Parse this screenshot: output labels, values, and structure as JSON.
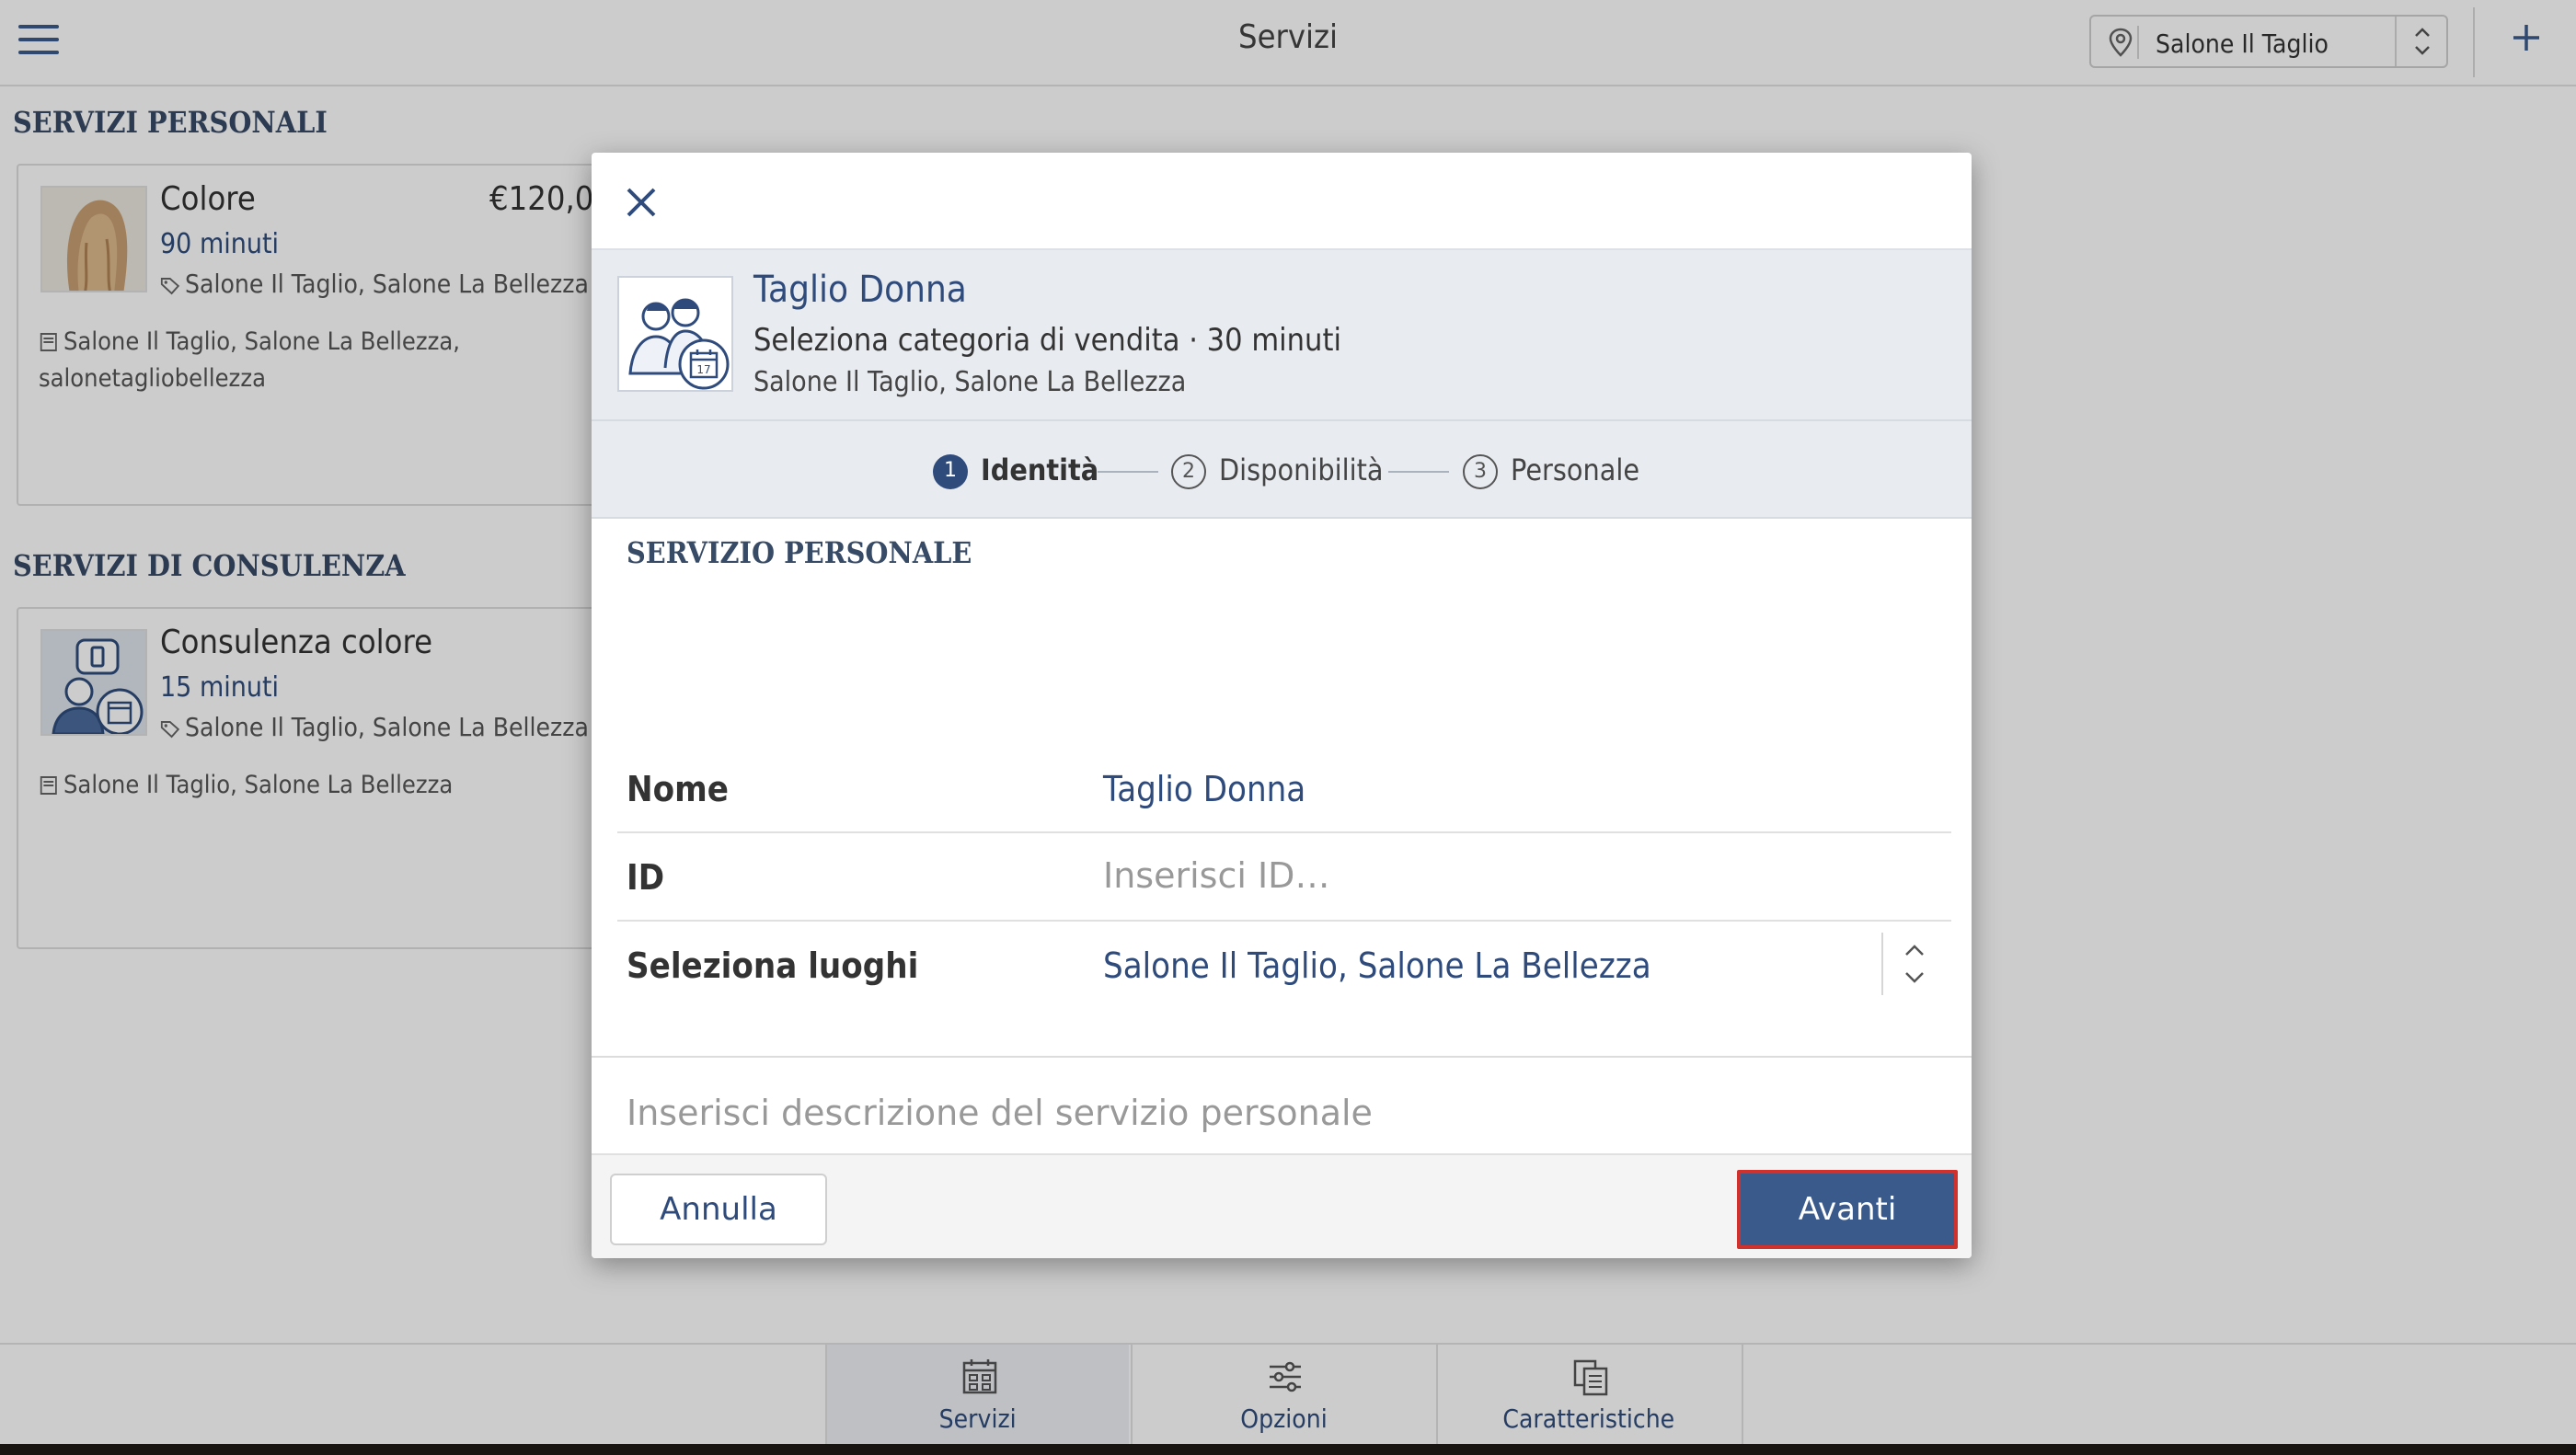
{
  "topbar": {
    "title": "Servizi",
    "location_value": "Salone Il Taglio"
  },
  "sections": [
    {
      "title": "SERVIZI PERSONALI",
      "card": {
        "name": "Colore",
        "price": "€120,0(",
        "duration": "90 minuti",
        "locations": "Salone Il Taglio, Salone La Bellezza",
        "sales_line1": "Salone Il Taglio, Salone La Bellezza,",
        "sales_line2": "salonetagliobellezza"
      }
    },
    {
      "title": "SERVIZI DI CONSULENZA",
      "card": {
        "name": "Consulenza colore",
        "duration": "15 minuti",
        "locations": "Salone Il Taglio, Salone La Bellezza",
        "sales_line1": "Salone Il Taglio, Salone La Bellezza"
      }
    }
  ],
  "bottom_tabs": [
    {
      "label": "Servizi",
      "icon": "grid-calendar-icon",
      "active": true
    },
    {
      "label": "Opzioni",
      "icon": "sliders-icon",
      "active": false
    },
    {
      "label": "Caratteristiche",
      "icon": "copy-list-icon",
      "active": false
    }
  ],
  "modal": {
    "header": {
      "title": "Taglio Donna",
      "subtitle": "Seleziona categoria di vendita · 30 minuti",
      "locations": "Salone Il Taglio, Salone La Bellezza"
    },
    "steps": [
      {
        "num": "1",
        "label": "Identità",
        "active": true
      },
      {
        "num": "2",
        "label": "Disponibilità",
        "active": false
      },
      {
        "num": "3",
        "label": "Personale",
        "active": false
      }
    ],
    "section_title": "SERVIZIO PERSONALE",
    "fields": {
      "name_label": "Nome",
      "name_value": "Taglio Donna",
      "id_label": "ID",
      "id_placeholder": "Inserisci ID…",
      "places_label": "Seleziona luoghi",
      "places_value": "Salone Il Taglio, Salone La Bellezza"
    },
    "description_placeholder": "Inserisci descrizione del servizio personale",
    "buttons": {
      "cancel": "Annulla",
      "next": "Avanti"
    }
  },
  "colors": {
    "accent": "#3a5a8c",
    "text_blue": "#2f4b7c",
    "highlight": "#d0312d"
  }
}
